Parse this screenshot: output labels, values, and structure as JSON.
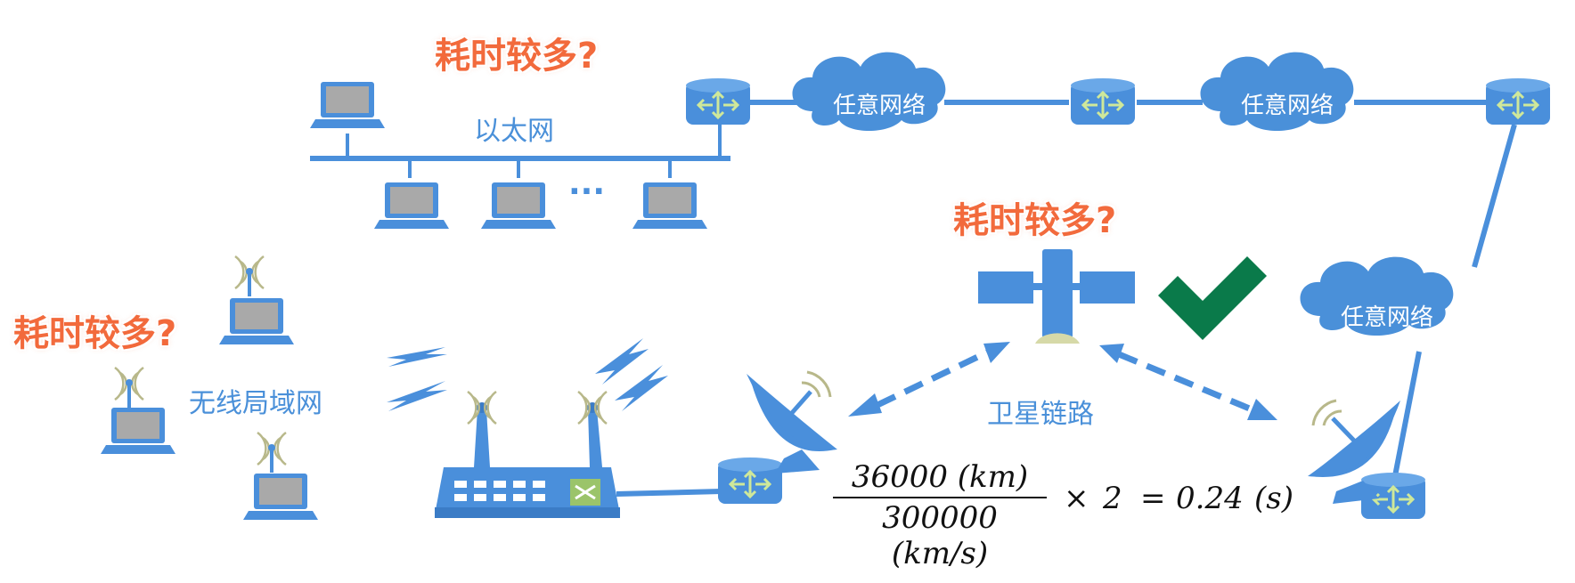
{
  "labels": {
    "question_top": "耗时较多?",
    "question_mid": "耗时较多?",
    "question_left": "耗时较多?",
    "ethernet": "以太网",
    "wlan": "无线局域网",
    "satellite_link": "卫星链路",
    "cloud_1": "任意网络",
    "cloud_2": "任意网络",
    "cloud_3": "任意网络",
    "ellipsis": "···"
  },
  "formula": {
    "numerator": "36000  (km)",
    "denominator": "300000  (km/s)",
    "times": "×",
    "factor": "2",
    "equals": "=",
    "result": "0.24",
    "unit": "(s)"
  },
  "colors": {
    "device_blue": "#4a8fdb",
    "cloud_blue": "#4a90d9",
    "question_orange": "#f26a3c",
    "check_green": "#0a7a4a",
    "signal_olive": "#b8b88a"
  }
}
